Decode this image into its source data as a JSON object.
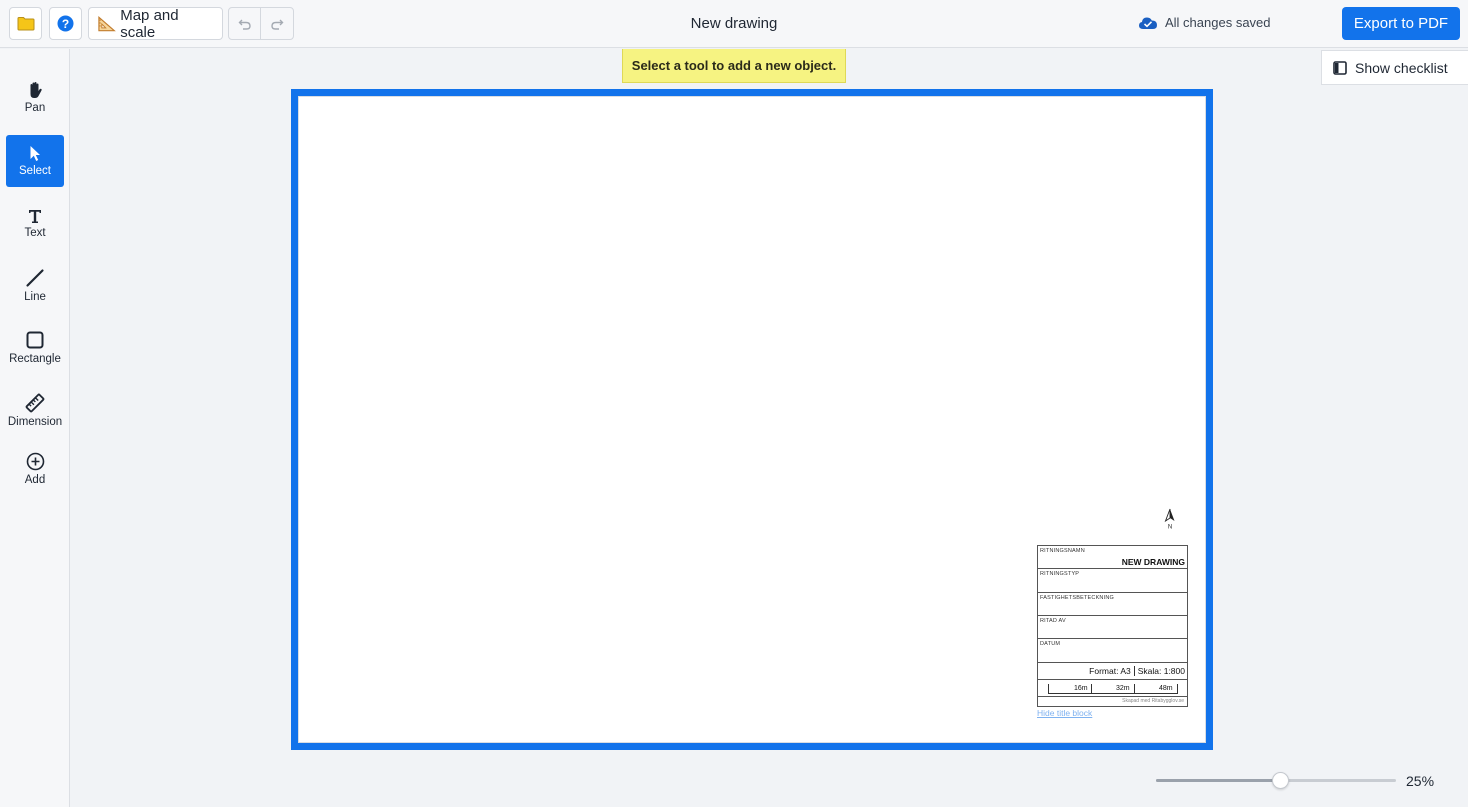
{
  "toolbar": {
    "map_scale_label": "Map and scale",
    "document_title": "New drawing",
    "save_status": "All changes saved",
    "export_label": "Export to PDF"
  },
  "sidebar": {
    "tools": [
      {
        "label": "Pan",
        "icon": "hand-icon",
        "active": false
      },
      {
        "label": "Select",
        "icon": "cursor-icon",
        "active": true
      },
      {
        "label": "Text",
        "icon": "text-icon",
        "active": false
      },
      {
        "label": "Line",
        "icon": "line-icon",
        "active": false
      },
      {
        "label": "Rectangle",
        "icon": "rectangle-icon",
        "active": false
      },
      {
        "label": "Dimension",
        "icon": "ruler-icon",
        "active": false
      },
      {
        "label": "Add",
        "icon": "plus-circle-icon",
        "active": false
      }
    ]
  },
  "hint": "Select a tool to add a new object.",
  "checklist_label": "Show checklist",
  "drawing": {
    "north_label": "N",
    "title_block": {
      "name_label": "RITNINGSNAMN",
      "name_value": "NEW DRAWING",
      "type_label": "RITNINGSTYP",
      "property_label": "FASTIGHETSBETECKNING",
      "drawn_by_label": "RITAD AV",
      "date_label": "DATUM",
      "format": "Format: A3",
      "scale": "Skala: 1:800",
      "scalebar": [
        "16m",
        "32m",
        "48m"
      ],
      "credit": "Skapad med Ritabygglov.se"
    },
    "hide_title_block": "Hide title block"
  },
  "zoom": {
    "label": "25%",
    "level": 0.52
  },
  "colors": {
    "accent": "#1273eb",
    "hint_bg": "#f6f382"
  }
}
